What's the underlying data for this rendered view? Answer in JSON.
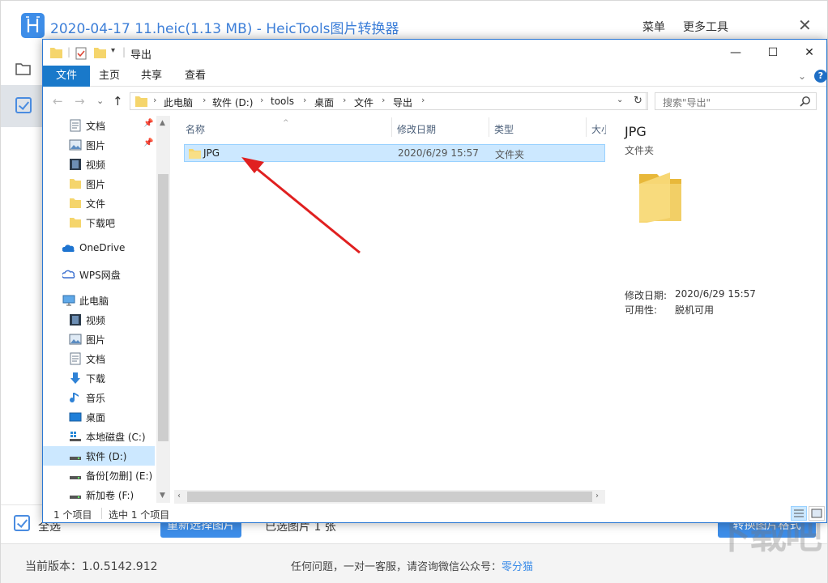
{
  "app": {
    "title": "2020-04-17 11.heic(1.13 MB) - HeicTools图片转换器",
    "menu_label": "菜单",
    "more_tools_label": "更多工具",
    "close_glyph": "✕",
    "select_all_label": "全选",
    "reselect_button": "重新选择图片",
    "selected_count_text": "已选图片 1 张",
    "convert_button": "转换图片格式",
    "version_text": "当前版本：1.0.5142.912",
    "contact_prefix": "任何问题，一对一客服，请咨询微信公众号：",
    "contact_link": "零分猫",
    "watermark": "下载吧",
    "accent_color": "#3d8de8"
  },
  "dialog": {
    "title": "导出",
    "quick_access_dropdown": "▾",
    "window_buttons": {
      "minimize": "—",
      "maximize": "☐",
      "close": "✕"
    },
    "ribbon": {
      "tabs": [
        "文件",
        "主页",
        "共享",
        "查看"
      ],
      "expand_glyph": "⌄",
      "help_glyph": "?"
    },
    "nav_buttons": {
      "back": "←",
      "forward": "→",
      "recent": "⌄",
      "up": "↑"
    },
    "breadcrumb": [
      "此电脑",
      "软件 (D:)",
      "tools",
      "桌面",
      "文件",
      "导出"
    ],
    "breadcrumb_sep": "›",
    "address_dropdown": "⌄",
    "refresh_glyph": "↻",
    "search_placeholder": "搜索\"导出\"",
    "nav_pane": {
      "quick_access": [
        {
          "label": "文档",
          "icon": "document-icon",
          "pinned": true
        },
        {
          "label": "图片",
          "icon": "pictures-icon",
          "pinned": true
        },
        {
          "label": "视频",
          "icon": "video-icon",
          "pinned": false
        },
        {
          "label": "图片",
          "icon": "folder-icon",
          "pinned": false
        },
        {
          "label": "文件",
          "icon": "folder-icon",
          "pinned": false
        },
        {
          "label": "下载吧",
          "icon": "folder-icon",
          "pinned": false
        }
      ],
      "onedrive": "OneDrive",
      "wps": "WPS网盘",
      "this_pc": "此电脑",
      "pc_items": [
        {
          "label": "视频",
          "icon": "video-icon"
        },
        {
          "label": "图片",
          "icon": "pictures-icon"
        },
        {
          "label": "文档",
          "icon": "document-icon"
        },
        {
          "label": "下载",
          "icon": "download-icon"
        },
        {
          "label": "音乐",
          "icon": "music-icon"
        },
        {
          "label": "桌面",
          "icon": "desktop-icon"
        },
        {
          "label": "本地磁盘 (C:)",
          "icon": "windows-drive-icon"
        },
        {
          "label": "软件 (D:)",
          "icon": "drive-icon",
          "selected": true
        },
        {
          "label": "备份[勿删] (E:)",
          "icon": "drive-icon"
        },
        {
          "label": "新加卷 (F:)",
          "icon": "drive-icon"
        }
      ],
      "pin_glyph": "📌"
    },
    "columns": [
      "名称",
      "修改日期",
      "类型",
      "大小"
    ],
    "sort_glyph": "^",
    "files": [
      {
        "name": "JPG",
        "modified": "2020/6/29 15:57",
        "type": "文件夹"
      }
    ],
    "details": {
      "name": "JPG",
      "type": "文件夹",
      "modified_label": "修改日期:",
      "modified_value": "2020/6/29 15:57",
      "availability_label": "可用性:",
      "availability_value": "脱机可用"
    },
    "status": {
      "item_count": "1 个项目",
      "selected": "选中 1 个项目"
    },
    "scroll_glyphs": {
      "up": "▲",
      "down": "▼",
      "left": "‹",
      "right": "›"
    }
  },
  "annotation_color": "#e02020"
}
